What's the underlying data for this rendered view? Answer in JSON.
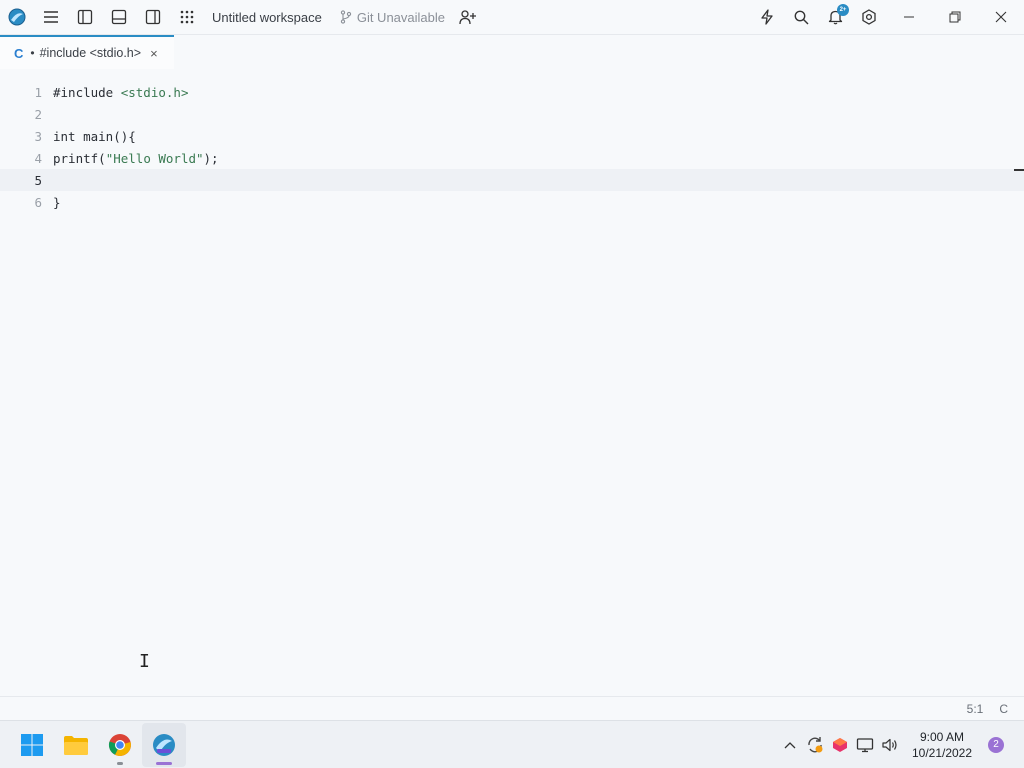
{
  "titlebar": {
    "workspace": "Untitled workspace",
    "git": "Git Unavailable",
    "notification_badge": "2+"
  },
  "tab": {
    "lang": "C",
    "dot": "•",
    "title": "#include <stdio.h>",
    "close": "×"
  },
  "editor": {
    "lines": [
      {
        "num": "1",
        "text": "#include <stdio.h>"
      },
      {
        "num": "2",
        "text": ""
      },
      {
        "num": "3",
        "text": "int main(){"
      },
      {
        "num": "4",
        "text": "printf(\"Hello World\");"
      },
      {
        "num": "5",
        "text": ""
      },
      {
        "num": "6",
        "text": "}"
      }
    ]
  },
  "statusbar": {
    "position": "5:1",
    "language": "C"
  },
  "taskbar": {
    "time": "9:00 AM",
    "date": "10/21/2022",
    "notifications": "2"
  },
  "colors": {
    "accent": "#2a8cc4",
    "background": "#f7f9fb"
  }
}
